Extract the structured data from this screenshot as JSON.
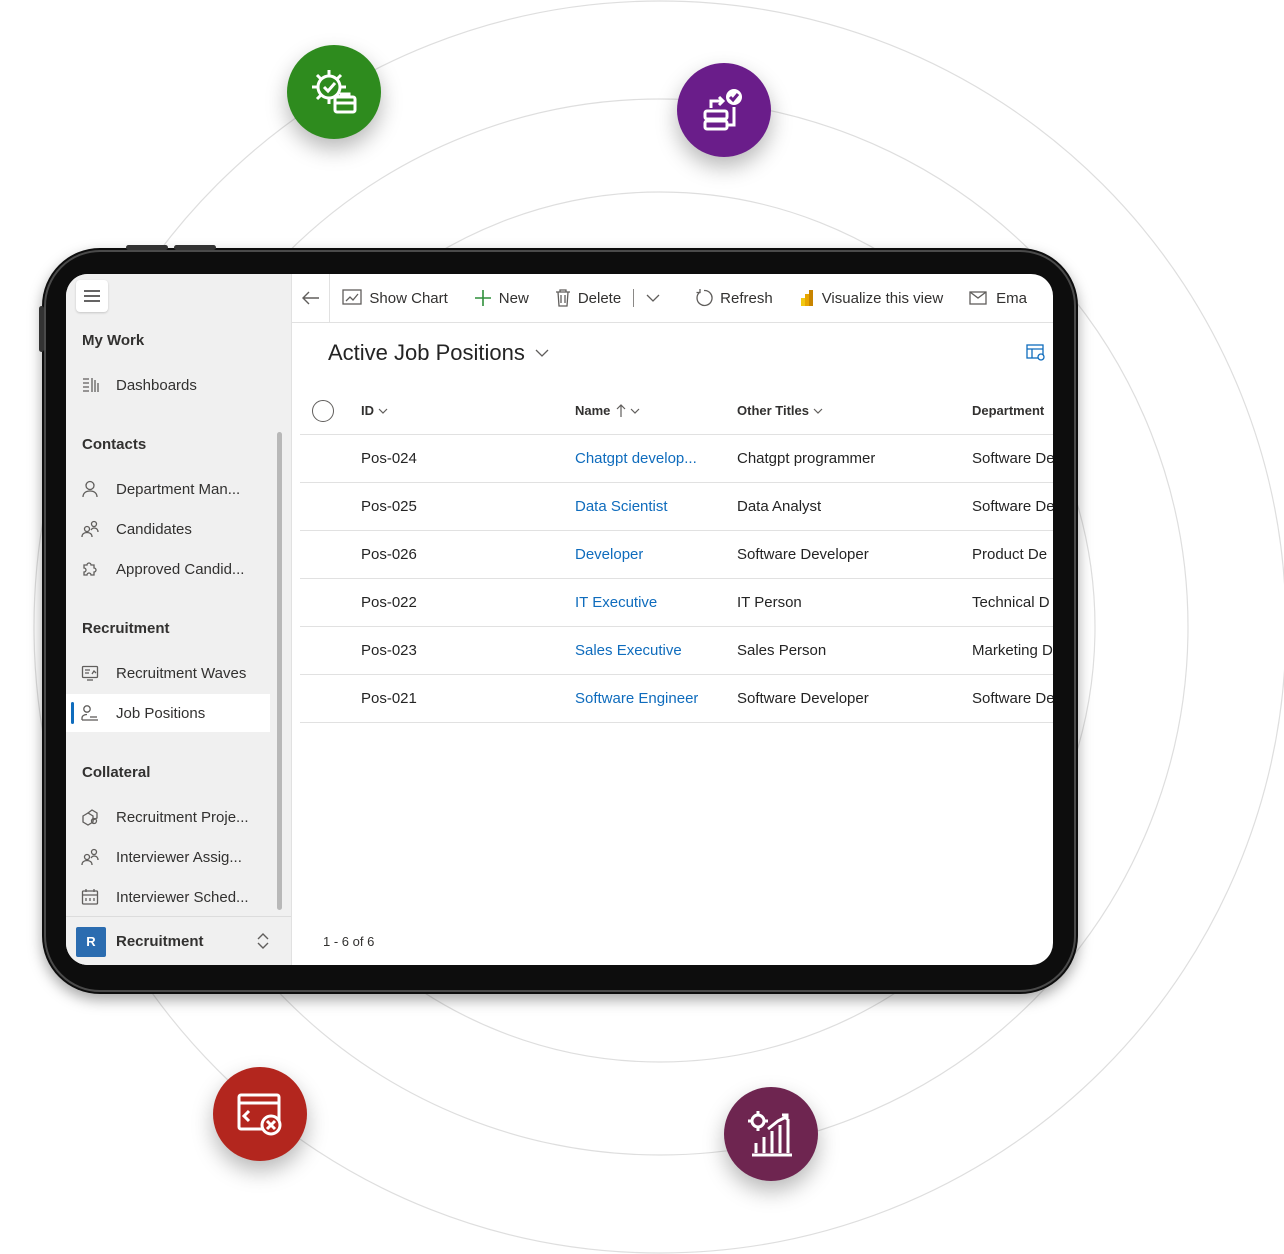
{
  "sidebar": {
    "sections": [
      {
        "title": "My Work",
        "items": [
          {
            "label": "Dashboards",
            "icon": "dashboard-icon"
          }
        ]
      },
      {
        "title": "Contacts",
        "items": [
          {
            "label": "Department Man...",
            "icon": "person-icon"
          },
          {
            "label": "Candidates",
            "icon": "people-icon"
          },
          {
            "label": "Approved Candid...",
            "icon": "puzzle-icon"
          }
        ]
      },
      {
        "title": "Recruitment",
        "items": [
          {
            "label": "Recruitment Waves",
            "icon": "waves-icon"
          },
          {
            "label": "Job Positions",
            "icon": "job-position-icon",
            "selected": true
          }
        ]
      },
      {
        "title": "Collateral",
        "items": [
          {
            "label": "Recruitment Proje...",
            "icon": "project-icon"
          },
          {
            "label": "Interviewer Assig...",
            "icon": "people-icon"
          },
          {
            "label": "Interviewer Sched...",
            "icon": "calendar-icon"
          }
        ]
      }
    ],
    "area": {
      "badge": "R",
      "name": "Recruitment"
    }
  },
  "commandbar": {
    "show_chart": "Show Chart",
    "new": "New",
    "delete": "Delete",
    "refresh": "Refresh",
    "visualize": "Visualize this view",
    "email": "Ema"
  },
  "view": {
    "title": "Active Job Positions"
  },
  "grid": {
    "columns": [
      "ID",
      "Name",
      "Other Titles",
      "Department"
    ],
    "rows": [
      {
        "id": "Pos-024",
        "name": "Chatgpt develop...",
        "other": "Chatgpt programmer",
        "dept": "Software De"
      },
      {
        "id": "Pos-025",
        "name": "Data Scientist",
        "other": "Data Analyst",
        "dept": "Software De"
      },
      {
        "id": "Pos-026",
        "name": "Developer",
        "other": "Software Developer",
        "dept": "Product De"
      },
      {
        "id": "Pos-022",
        "name": "IT Executive",
        "other": "IT Person",
        "dept": "Technical D"
      },
      {
        "id": "Pos-023",
        "name": "Sales Executive",
        "other": "Sales Person",
        "dept": "Marketing D"
      },
      {
        "id": "Pos-021",
        "name": "Software Engineer",
        "other": "Software Developer",
        "dept": "Software De"
      }
    ],
    "footer": "1 - 6 of 6"
  },
  "colors": {
    "accent": "#0f6cbd",
    "bubble_green": "#2e8b1e",
    "bubble_purple": "#6a1d8a",
    "bubble_red": "#b3261e",
    "bubble_plum": "#6e2550"
  },
  "bubbles": [
    {
      "icon": "gear-briefcase-icon"
    },
    {
      "icon": "workflow-server-icon"
    },
    {
      "icon": "code-window-error-icon"
    },
    {
      "icon": "growth-chart-gear-icon"
    }
  ]
}
